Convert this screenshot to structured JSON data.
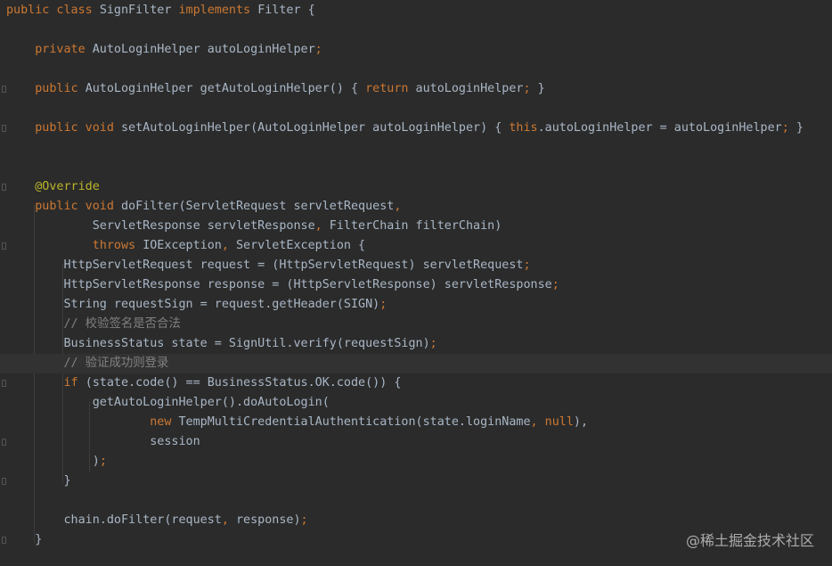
{
  "editor": {
    "lines": [
      {
        "tokens": [
          {
            "t": "public class ",
            "c": "kw"
          },
          {
            "t": "SignFilter ",
            "c": "id"
          },
          {
            "t": "implements ",
            "c": "kw"
          },
          {
            "t": "Filter {",
            "c": "id"
          }
        ]
      },
      {
        "tokens": []
      },
      {
        "tokens": [
          {
            "t": "    private ",
            "c": "kw"
          },
          {
            "t": "AutoLoginHelper autoLoginHelper",
            "c": "id"
          },
          {
            "t": ";",
            "c": "mk"
          }
        ]
      },
      {
        "tokens": []
      },
      {
        "tokens": [
          {
            "t": "    public ",
            "c": "kw"
          },
          {
            "t": "AutoLoginHelper getAutoLoginHelper() { ",
            "c": "id"
          },
          {
            "t": "return ",
            "c": "kw"
          },
          {
            "t": "autoLoginHelper",
            "c": "id"
          },
          {
            "t": "; ",
            "c": "mk"
          },
          {
            "t": "}",
            "c": "id"
          }
        ]
      },
      {
        "tokens": []
      },
      {
        "tokens": [
          {
            "t": "    public void ",
            "c": "kw"
          },
          {
            "t": "setAutoLoginHelper(AutoLoginHelper autoLoginHelper) { ",
            "c": "id"
          },
          {
            "t": "this",
            "c": "kw"
          },
          {
            "t": ".autoLoginHelper = autoLoginHelper",
            "c": "id"
          },
          {
            "t": "; ",
            "c": "mk"
          },
          {
            "t": "}",
            "c": "id"
          }
        ]
      },
      {
        "tokens": []
      },
      {
        "tokens": []
      },
      {
        "tokens": [
          {
            "t": "    @Override",
            "c": "ann"
          }
        ]
      },
      {
        "tokens": [
          {
            "t": "    public void ",
            "c": "kw"
          },
          {
            "t": "doFilter(ServletRequest servletRequest",
            "c": "id"
          },
          {
            "t": ",",
            "c": "mk"
          }
        ]
      },
      {
        "tokens": [
          {
            "t": "            ServletResponse servletResponse",
            "c": "id"
          },
          {
            "t": ", ",
            "c": "mk"
          },
          {
            "t": "FilterChain filterChain)",
            "c": "id"
          }
        ]
      },
      {
        "tokens": [
          {
            "t": "            throws ",
            "c": "kw"
          },
          {
            "t": "IOException",
            "c": "id"
          },
          {
            "t": ", ",
            "c": "mk"
          },
          {
            "t": "ServletException {",
            "c": "id"
          }
        ]
      },
      {
        "tokens": [
          {
            "t": "        HttpServletRequest request = (HttpServletRequest) servletRequest",
            "c": "id"
          },
          {
            "t": ";",
            "c": "mk"
          }
        ]
      },
      {
        "tokens": [
          {
            "t": "        HttpServletResponse response = (HttpServletResponse) servletResponse",
            "c": "id"
          },
          {
            "t": ";",
            "c": "mk"
          }
        ]
      },
      {
        "tokens": [
          {
            "t": "        String requestSign = request.getHeader(SIGN)",
            "c": "id"
          },
          {
            "t": ";",
            "c": "mk"
          }
        ]
      },
      {
        "tokens": [
          {
            "t": "        // 校验签名是否合法",
            "c": "cm"
          }
        ]
      },
      {
        "tokens": [
          {
            "t": "        BusinessStatus state = SignUtil.verify(requestSign)",
            "c": "id"
          },
          {
            "t": ";",
            "c": "mk"
          }
        ]
      },
      {
        "tokens": [
          {
            "t": "        // 验证成功则登录",
            "c": "cm"
          }
        ],
        "current": true
      },
      {
        "tokens": [
          {
            "t": "        if ",
            "c": "kw"
          },
          {
            "t": "(state.code() == BusinessStatus.OK.code()) {",
            "c": "id"
          }
        ]
      },
      {
        "tokens": [
          {
            "t": "            getAutoLoginHelper().doAutoLogin(",
            "c": "id"
          }
        ]
      },
      {
        "tokens": [
          {
            "t": "                    new ",
            "c": "kw"
          },
          {
            "t": "TempMultiCredentialAuthentication(state.loginName",
            "c": "id"
          },
          {
            "t": ", ",
            "c": "mk"
          },
          {
            "t": "null",
            "c": "kw"
          },
          {
            "t": "),",
            "c": "id"
          }
        ]
      },
      {
        "tokens": [
          {
            "t": "                    session",
            "c": "id"
          }
        ]
      },
      {
        "tokens": [
          {
            "t": "            )",
            "c": "id"
          },
          {
            "t": ";",
            "c": "mk"
          }
        ]
      },
      {
        "tokens": [
          {
            "t": "        }",
            "c": "id"
          }
        ]
      },
      {
        "tokens": []
      },
      {
        "tokens": [
          {
            "t": "        chain.doFilter(request",
            "c": "id"
          },
          {
            "t": ", ",
            "c": "mk"
          },
          {
            "t": "response)",
            "c": "id"
          },
          {
            "t": ";",
            "c": "mk"
          }
        ]
      },
      {
        "tokens": [
          {
            "t": "    }",
            "c": "id"
          }
        ]
      }
    ]
  },
  "watermark": "@稀土掘金技术社区"
}
